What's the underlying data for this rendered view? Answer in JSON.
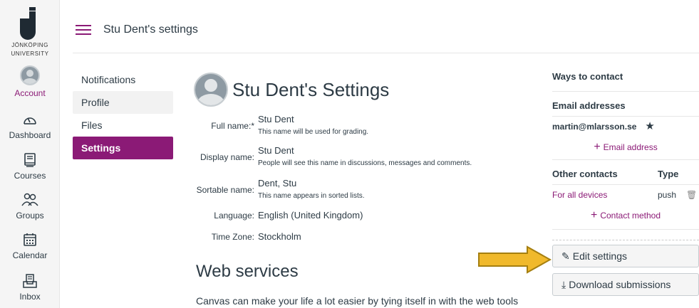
{
  "global_nav": {
    "logo_text_line1": "JÖNKÖPING",
    "logo_text_line2": "UNIVERSITY",
    "items": [
      {
        "label": "Account",
        "icon": "user-avatar-icon"
      },
      {
        "label": "Dashboard",
        "icon": "dashboard-gauge-icon"
      },
      {
        "label": "Courses",
        "icon": "book-icon"
      },
      {
        "label": "Groups",
        "icon": "groups-people-icon"
      },
      {
        "label": "Calendar",
        "icon": "calendar-icon"
      },
      {
        "label": "Inbox",
        "icon": "inbox-icon"
      }
    ]
  },
  "header": {
    "breadcrumb": "Stu Dent's settings"
  },
  "subnav": {
    "items": [
      "Notifications",
      "Profile",
      "Files",
      "Settings"
    ],
    "active": "Settings"
  },
  "page": {
    "title": "Stu Dent's Settings",
    "fields": {
      "full_name_label": "Full name:*",
      "full_name": "Stu Dent",
      "full_name_hint": "This name will be used for grading.",
      "display_name_label": "Display name:",
      "display_name": "Stu Dent",
      "display_name_hint": "People will see this name in discussions, messages and comments.",
      "sortable_name_label": "Sortable name:",
      "sortable_name": "Dent, Stu",
      "sortable_name_hint": "This name appears in sorted lists.",
      "language_label": "Language:",
      "language": "English (United Kingdom)",
      "timezone_label": "Time Zone:",
      "timezone": "Stockholm"
    },
    "web_services_heading": "Web services",
    "web_services_text": "Canvas can make your life a lot easier by tying itself in with the web tools"
  },
  "sidebar": {
    "ways_title": "Ways to contact",
    "email_header": "Email addresses",
    "email": "martin@mlarsson.se",
    "add_email": "Email address",
    "other_header": "Other contacts",
    "type_header": "Type",
    "other_contact": "For all devices",
    "other_type": "push",
    "add_contact": "Contact method",
    "edit_button": "Edit settings",
    "download_button": "Download submissions"
  },
  "colors": {
    "accent": "#8b1a76",
    "arrow_fill": "#f0b92c",
    "arrow_stroke": "#a57f10"
  }
}
